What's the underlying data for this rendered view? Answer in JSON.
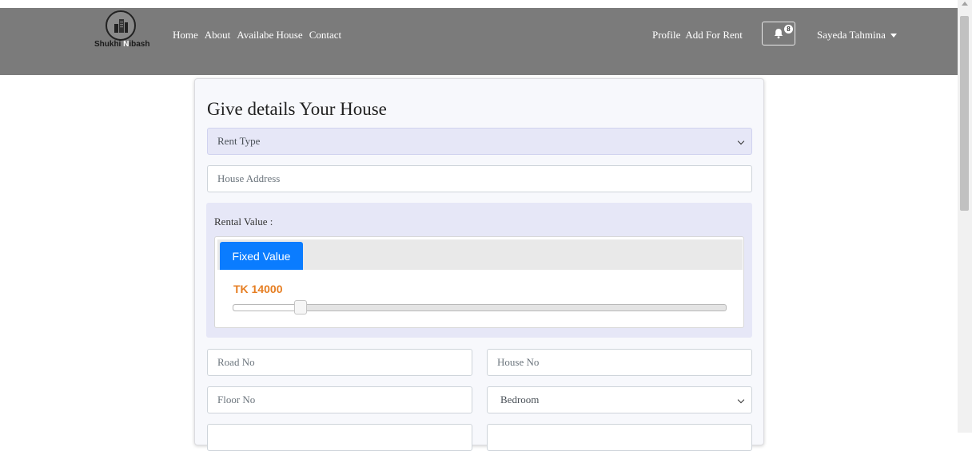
{
  "brand": {
    "part1": "Shukhi ",
    "part2": "N",
    "part3": "ibash"
  },
  "nav": {
    "left": [
      "Home",
      "About",
      "Availabe House",
      "Contact"
    ],
    "profile": "Profile",
    "add_for_rent": "Add For Rent",
    "notification_count": "8",
    "user_name": "Sayeda Tahmina"
  },
  "form": {
    "title": "Give details Your House",
    "rent_type": "Rent Type",
    "house_address_placeholder": "House Address",
    "rental_value_label": "Rental Value :",
    "tab_fixed": "Fixed Value",
    "price_text": "TK 14000",
    "slider_fraction": 0.138,
    "road_no_placeholder": "Road No",
    "house_no_placeholder": "House No",
    "floor_no_placeholder": "Floor No",
    "bedroom": "Bedroom"
  },
  "colors": {
    "navbar": "#7b7b7b",
    "accent_blue": "#0a7cff",
    "price_orange": "#e67e22",
    "select_bg": "#e6e7f7"
  }
}
